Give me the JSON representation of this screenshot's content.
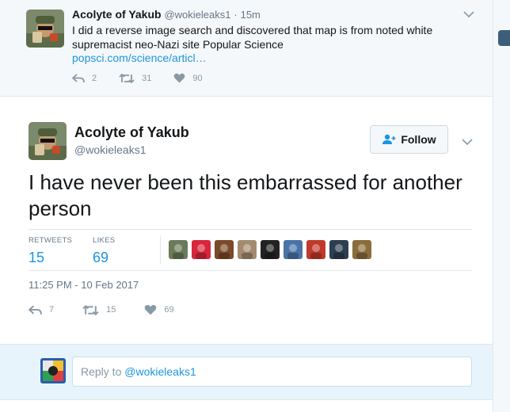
{
  "parent_tweet": {
    "name": "Acolyte of Yakub",
    "handle": "@wokieleaks1",
    "separator": "·",
    "time": "15m",
    "text": "I did a reverse image search and discovered that map is from noted white supremacist neo-Nazi site Popular Science",
    "link": "popsci.com/science/articl…",
    "replies": "2",
    "retweets": "31",
    "likes": "90"
  },
  "main_tweet": {
    "name": "Acolyte of Yakub",
    "handle": "@wokieleaks1",
    "follow_label": "Follow",
    "text": "I have never been this embarrassed for another person",
    "retweets_label": "RETWEETS",
    "retweets_count": "15",
    "likes_label": "LIKES",
    "likes_count": "69",
    "timestamp": "11:25 PM - 10 Feb 2017",
    "replies": "7",
    "retweets": "15",
    "likes": "69"
  },
  "likers": [
    "#6b7a5a",
    "#d7263d",
    "#7a4a2a",
    "#a38b70",
    "#222222",
    "#4a74a8",
    "#c0392b",
    "#2c3e50",
    "#8a6d3b"
  ],
  "reply_box": {
    "prefix": "Reply to ",
    "mention": "@wokieleaks1"
  },
  "colors": {
    "link": "#1b95e0",
    "muted": "#657786",
    "icon": "#8899a6"
  }
}
